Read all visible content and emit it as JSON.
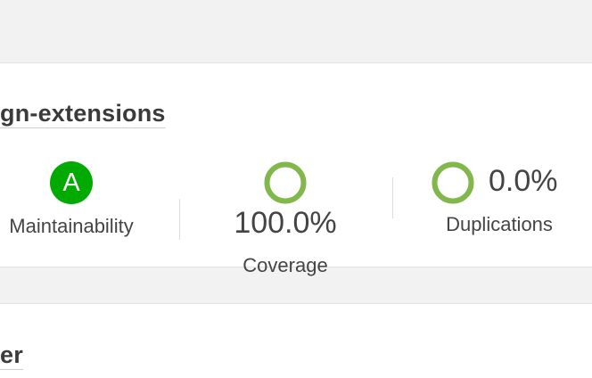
{
  "projects": [
    {
      "name": "gn-extensions",
      "maintainability": {
        "grade": "A",
        "label": "Maintainability",
        "color": "#00aa00"
      },
      "coverage": {
        "value": "100.0%",
        "label": "Coverage",
        "ring_color": "#82b74b"
      },
      "duplications": {
        "value": "0.0%",
        "label": "Duplications",
        "ring_color": "#82b74b"
      }
    },
    {
      "name": "er"
    }
  ]
}
